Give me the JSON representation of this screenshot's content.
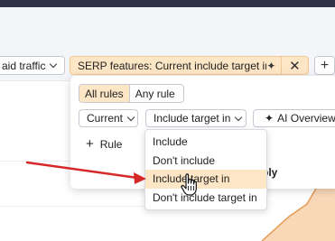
{
  "filters": {
    "paid_traffic_label": "aid traffic",
    "serp_chip_label": "SERP features: Current include target in",
    "serp_close_glyph": "✕",
    "add_filter_glyph": "+"
  },
  "panel": {
    "rule_toggle": {
      "all": "All rules",
      "any": "Any rule",
      "selected": "All rules"
    },
    "current_dropdown": "Current",
    "include_dropdown": "Include target in",
    "ai_overview": "AI Overview",
    "add_rule": "Rule",
    "apply": "ply"
  },
  "menu": {
    "items": [
      {
        "label": "Include"
      },
      {
        "label": "Don't include"
      },
      {
        "label": "Include target in"
      },
      {
        "label": "Don't include target in"
      }
    ],
    "highlighted_index": 2
  },
  "colors": {
    "accent_bg": "#fde6c5",
    "accent_border": "#f3c791",
    "top_bar": "#2d3244",
    "arrow": "#d62828",
    "chart_area": "#f6c89a"
  },
  "icons": {
    "sparkle": "sparkle-icon",
    "cursor": "hand-cursor-icon",
    "chevron": "chevron-down-icon"
  }
}
